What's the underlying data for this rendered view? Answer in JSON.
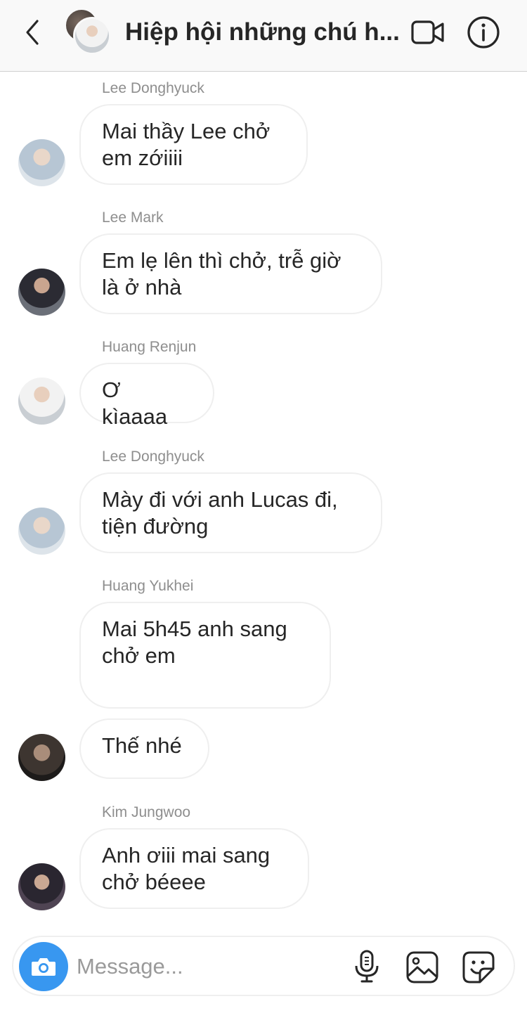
{
  "header": {
    "title": "Hiệp hội những chú h...",
    "icons": {
      "back": "chevron-left-icon",
      "video": "video-camera-icon",
      "info": "info-icon"
    }
  },
  "messages": [
    {
      "sender": "Lee Donghyuck",
      "text": "Mai thầy Lee chở em zớiiii"
    },
    {
      "sender": "Lee Mark",
      "text": "Em lẹ lên thì chở, trễ giờ là ở nhà"
    },
    {
      "sender": "Huang Renjun",
      "text": "Ơ kìaaaa"
    },
    {
      "sender": "Lee Donghyuck",
      "text": "Mày đi với anh Lucas đi, tiện đường"
    },
    {
      "sender": "Huang Yukhei",
      "text": "Mai 5h45 anh sang chở em"
    },
    {
      "sender": "",
      "text": "Thế nhé"
    },
    {
      "sender": "Kim Jungwoo",
      "text": "Anh ơiii mai sang chở béeee"
    }
  ],
  "composer": {
    "placeholder": "Message...",
    "icons": {
      "camera": "camera-icon",
      "mic": "microphone-icon",
      "gallery": "gallery-icon",
      "sticker": "sticker-icon"
    }
  },
  "colors": {
    "accent": "#3897f0",
    "bubble_border": "#efefef",
    "sender_text": "#8e8e8e"
  }
}
